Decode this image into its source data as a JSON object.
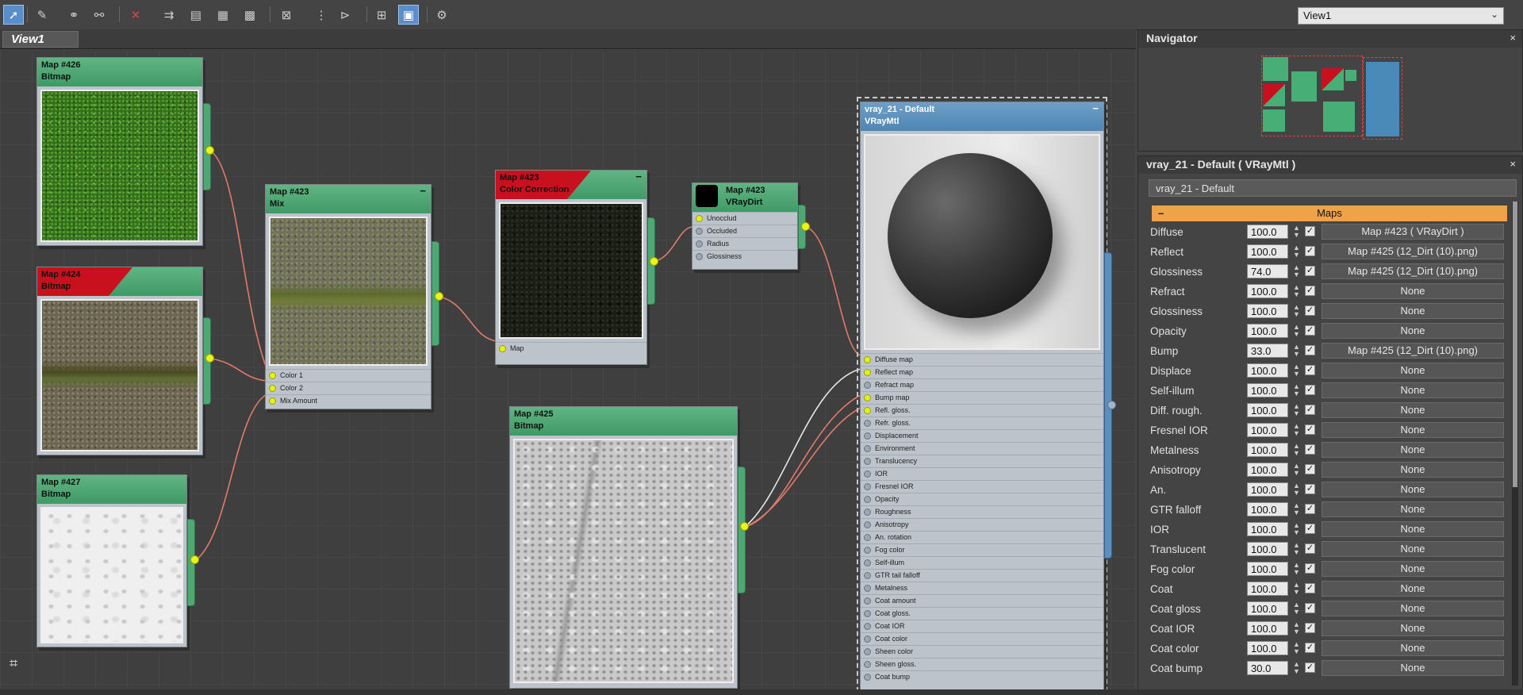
{
  "toolbar": {
    "icons": [
      "select-arrow-icon",
      "pick-material-icon",
      "get-material-icon",
      "put-material-icon",
      "delete-icon",
      "move-children-icon",
      "assign-material-icon",
      "checker-background-icon",
      "checker-icon",
      "render-preview-icon",
      "layout-icon",
      "layout-children-icon",
      "grid-icon",
      "show-end-result-icon",
      "options-icon"
    ],
    "view_select_value": "View1"
  },
  "tabs": [
    {
      "label": "View1"
    }
  ],
  "nodes": {
    "n426": {
      "title": "Map #426",
      "type": "Bitmap"
    },
    "n424": {
      "title": "Map #424",
      "type": "Bitmap"
    },
    "n427": {
      "title": "Map #427",
      "type": "Bitmap"
    },
    "n423mix": {
      "title": "Map #423",
      "type": "Mix",
      "slots": [
        "Color 1",
        "Color 2",
        "Mix Amount"
      ]
    },
    "n423cc": {
      "title": "Map #423",
      "type": "Color Correction",
      "slots": [
        "Map"
      ]
    },
    "n423dirt": {
      "title": "Map #423",
      "type": "VRayDirt",
      "slots": [
        "Unocclud",
        "Occluded",
        "Radius",
        "Glossiness"
      ]
    },
    "n425": {
      "title": "Map #425",
      "type": "Bitmap"
    },
    "vray": {
      "title": "vray_21 - Default",
      "type": "VRayMtl",
      "slots": [
        "Diffuse map",
        "Reflect map",
        "Refract map",
        "Bump map",
        "Refl. gloss.",
        "Refr. gloss.",
        "Displacement",
        "Environment",
        "Translucency",
        "IOR",
        "Fresnel IOR",
        "Opacity",
        "Roughness",
        "Anisotropy",
        "An. rotation",
        "Fog color",
        "Self-illum",
        "GTR tail falloff",
        "Metalness",
        "Coat amount",
        "Coat gloss.",
        "Coat IOR",
        "Coat color",
        "Sheen color",
        "Sheen gloss.",
        "Coat bump"
      ]
    }
  },
  "navigator": {
    "title": "Navigator",
    "close": "×"
  },
  "material_panel": {
    "title": "vray_21 - Default  ( VRayMtl )",
    "close": "×",
    "name_value": "vray_21 - Default",
    "section": "Maps",
    "collapse": "–",
    "rows": [
      {
        "label": "Diffuse",
        "value": "100.0",
        "map": "Map #423  ( VRayDirt )"
      },
      {
        "label": "Reflect",
        "value": "100.0",
        "map": "Map #425 (12_Dirt (10).png)"
      },
      {
        "label": "Glossiness",
        "value": "74.0",
        "map": "Map #425 (12_Dirt (10).png)"
      },
      {
        "label": "Refract",
        "value": "100.0",
        "map": "None"
      },
      {
        "label": "Glossiness",
        "value": "100.0",
        "map": "None"
      },
      {
        "label": "Opacity",
        "value": "100.0",
        "map": "None"
      },
      {
        "label": "Bump",
        "value": "33.0",
        "map": "Map #425 (12_Dirt (10).png)"
      },
      {
        "label": "Displace",
        "value": "100.0",
        "map": "None"
      },
      {
        "label": "Self-illum",
        "value": "100.0",
        "map": "None"
      },
      {
        "label": "Diff. rough.",
        "value": "100.0",
        "map": "None"
      },
      {
        "label": "Fresnel IOR",
        "value": "100.0",
        "map": "None"
      },
      {
        "label": "Metalness",
        "value": "100.0",
        "map": "None"
      },
      {
        "label": "Anisotropy",
        "value": "100.0",
        "map": "None"
      },
      {
        "label": "An.",
        "value": "100.0",
        "map": "None"
      },
      {
        "label": "GTR falloff",
        "value": "100.0",
        "map": "None"
      },
      {
        "label": "IOR",
        "value": "100.0",
        "map": "None"
      },
      {
        "label": "Translucent",
        "value": "100.0",
        "map": "None"
      },
      {
        "label": "Fog color",
        "value": "100.0",
        "map": "None"
      },
      {
        "label": "Coat",
        "value": "100.0",
        "map": "None"
      },
      {
        "label": "Coat gloss",
        "value": "100.0",
        "map": "None"
      },
      {
        "label": "Coat IOR",
        "value": "100.0",
        "map": "None"
      },
      {
        "label": "Coat color",
        "value": "100.0",
        "map": "None"
      },
      {
        "label": "Coat bump",
        "value": "30.0",
        "map": "None"
      }
    ]
  },
  "colors": {
    "node_header": "#4fa872",
    "active": "#5b8ec9",
    "maps_bar": "#f0a24a",
    "wire": "#e07a6a"
  }
}
